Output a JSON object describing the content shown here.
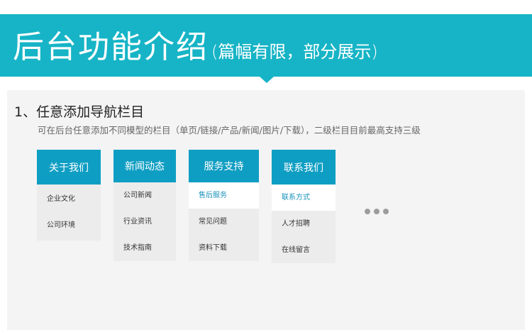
{
  "banner": {
    "title": "后台功能介绍",
    "subtitle": "(篇幅有限，部分展示)"
  },
  "section": {
    "title": "1、任意添加导航栏目",
    "description": "可在后台任意添加不同模型的栏目（单页/链接/产品/新闻/图片/下载），二级栏目目前最高支持三级"
  },
  "menus": [
    {
      "label": "关于我们",
      "items": [
        "企业文化",
        "公司环境"
      ]
    },
    {
      "label": "新闻动态",
      "items": [
        "公司新闻",
        "行业资讯",
        "技术指南"
      ]
    },
    {
      "label": "服务支持",
      "items": [
        "售后服务",
        "常见问题",
        "资料下载"
      ]
    },
    {
      "label": "联系我们",
      "items": [
        "联系方式",
        "人才招聘",
        "在线留言"
      ]
    }
  ],
  "colors": {
    "banner": "#16b4c6",
    "menu_header": "#0f9ec3",
    "active_item_text": "#1a93bb"
  },
  "more_icon": "ellipsis-icon"
}
